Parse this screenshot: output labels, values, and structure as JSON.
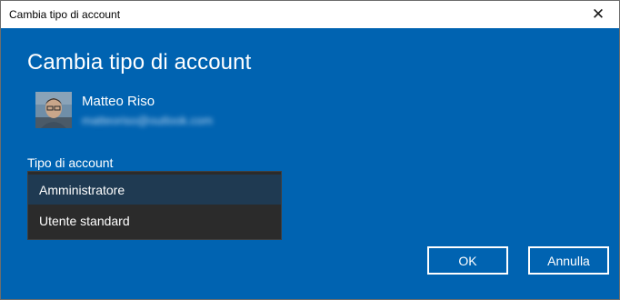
{
  "window": {
    "title": "Cambia tipo di account",
    "close_glyph": "✕"
  },
  "dialog": {
    "heading": "Cambia tipo di account",
    "user": {
      "name": "Matteo Riso",
      "email": "matteoriso@outlook.com",
      "email_blurred": true
    },
    "account_type": {
      "label": "Tipo di account",
      "options": [
        "Amministratore",
        "Utente standard"
      ],
      "selected": "Amministratore"
    },
    "buttons": {
      "ok": "OK",
      "cancel": "Annulla"
    }
  },
  "colors": {
    "accent_blue": "#0063b1",
    "dropdown_bg": "#2b2b2b",
    "dropdown_selected": "#1f3a52"
  },
  "icons": {
    "close": "close-icon",
    "avatar": "user-avatar"
  }
}
